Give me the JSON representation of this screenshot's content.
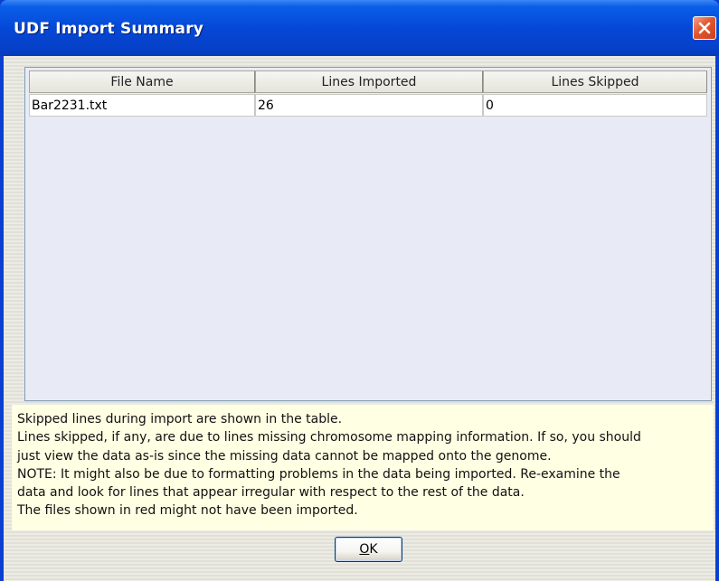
{
  "window": {
    "title": "UDF Import Summary",
    "close_icon": "close-icon"
  },
  "table": {
    "columns": [
      "File Name",
      "Lines Imported",
      "Lines Skipped"
    ],
    "rows": [
      [
        "Bar2231.txt",
        "26",
        "0"
      ]
    ]
  },
  "info": {
    "lines": [
      "Skipped lines during import are shown in the table.",
      "Lines skipped, if any, are due to lines missing chromosome mapping information. If so, you should",
      "just view the data as-is since the missing data cannot be mapped onto the genome.",
      "NOTE: It might also be due to formatting problems in the data being imported. Re-examine the",
      "data and look for lines that appear irregular with respect to the rest of the data.",
      "The files shown in red might not have been imported."
    ]
  },
  "buttons": {
    "ok_mnemonic": "O",
    "ok_rest": "K"
  },
  "colors": {
    "titlebar": "#0548d6",
    "close_button": "#e2562d",
    "info_background": "#ffffe4",
    "table_background": "#e8ebf5"
  }
}
